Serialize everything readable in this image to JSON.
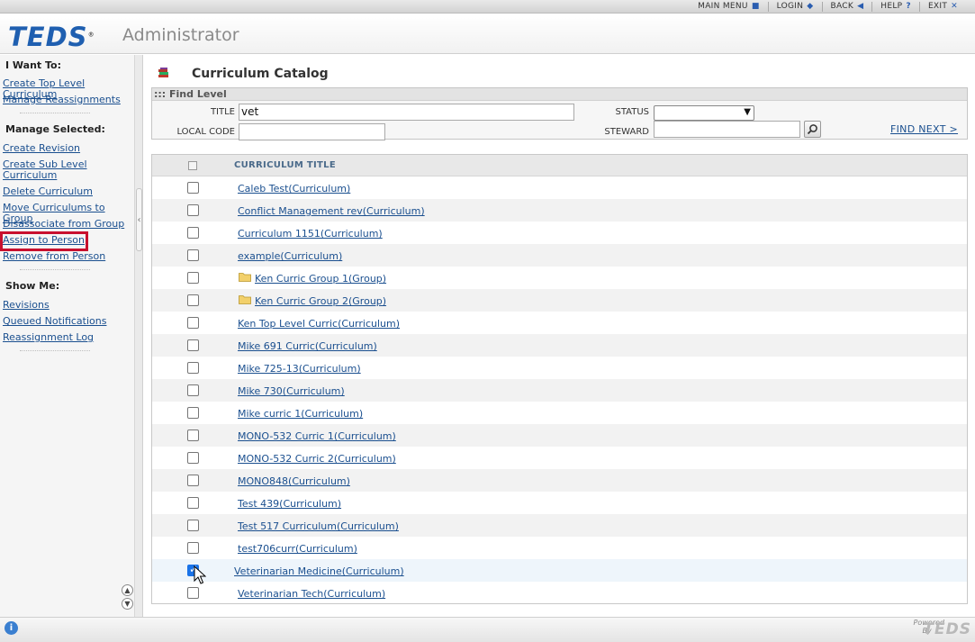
{
  "topnav": {
    "main_menu": "MAIN MENU",
    "login": "LOGIN",
    "back": "BACK",
    "help": "HELP",
    "exit": "EXIT"
  },
  "header": {
    "logo": "TEDS",
    "app_name": "Administrator"
  },
  "sidebar": {
    "i_want_to": "I Want To:",
    "i_want_to_items": [
      "Create Top Level Curriculum",
      "Manage Reassignments"
    ],
    "manage_selected": "Manage Selected:",
    "manage_items": [
      "Create Revision",
      "Create Sub Level",
      "Curriculum",
      "Delete Curriculum",
      "Move Curriculums to Group",
      "Disassociate from Group",
      "Assign to Person",
      "Remove from Person"
    ],
    "show_me": "Show Me:",
    "show_items": [
      "Revisions",
      "Queued Notifications",
      "Reassignment Log"
    ]
  },
  "page": {
    "title": "Curriculum Catalog"
  },
  "find": {
    "header": "::: Find Level",
    "title_label": "TITLE",
    "title_value": "vet",
    "local_code_label": "LOCAL CODE",
    "local_code_value": "",
    "status_label": "STATUS",
    "status_value": "",
    "steward_label": "STEWARD",
    "steward_value": "",
    "find_next": "FIND NEXT >"
  },
  "grid": {
    "column_title": "CURRICULUM TITLE",
    "rows": [
      {
        "label": "Caleb Test(Curriculum)",
        "group": false,
        "checked": false
      },
      {
        "label": "Conflict Management rev(Curriculum)",
        "group": false,
        "checked": false
      },
      {
        "label": "Curriculum 1151(Curriculum)",
        "group": false,
        "checked": false
      },
      {
        "label": "example(Curriculum)",
        "group": false,
        "checked": false
      },
      {
        "label": "Ken Curric Group 1(Group)",
        "group": true,
        "checked": false
      },
      {
        "label": "Ken Curric Group 2(Group)",
        "group": true,
        "checked": false
      },
      {
        "label": "Ken Top Level Curric(Curriculum)",
        "group": false,
        "checked": false
      },
      {
        "label": "Mike 691 Curric(Curriculum)",
        "group": false,
        "checked": false
      },
      {
        "label": "Mike 725-13(Curriculum)",
        "group": false,
        "checked": false
      },
      {
        "label": "Mike 730(Curriculum)",
        "group": false,
        "checked": false
      },
      {
        "label": "Mike curric 1(Curriculum)",
        "group": false,
        "checked": false
      },
      {
        "label": "MONO-532 Curric 1(Curriculum)",
        "group": false,
        "checked": false
      },
      {
        "label": "MONO-532 Curric 2(Curriculum)",
        "group": false,
        "checked": false
      },
      {
        "label": "MONO848(Curriculum)",
        "group": false,
        "checked": false
      },
      {
        "label": "Test 439(Curriculum)",
        "group": false,
        "checked": false
      },
      {
        "label": "Test 517 Curriculum(Curriculum)",
        "group": false,
        "checked": false
      },
      {
        "label": "test706curr(Curriculum)",
        "group": false,
        "checked": false
      },
      {
        "label": "Veterinarian Medicine(Curriculum)",
        "group": false,
        "checked": true
      },
      {
        "label": "Veterinarian Tech(Curriculum)",
        "group": false,
        "checked": false
      }
    ]
  },
  "footer": {
    "powered": "Powered",
    "by": "By",
    "logo": "TEDS"
  },
  "colors": {
    "brand_blue": "#1f5fb0",
    "link": "#1a4f8f",
    "highlight_red": "#c8102e"
  }
}
